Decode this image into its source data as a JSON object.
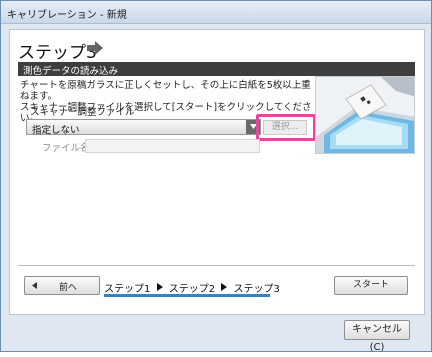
{
  "window": {
    "title": "キャリブレーション - 新規"
  },
  "step": {
    "title": "ステップ3"
  },
  "section": {
    "title": "測色データの読み込み"
  },
  "instructions": {
    "line1": "チャートを原稿ガラスに正しくセットし、その上に白紙を5枚以上重ねます。",
    "line2": "スキャナー調整ファイルを選択して[スタート]をクリックしてください。"
  },
  "scanner_file": {
    "label": "スキャナー調整ファイル",
    "selected": "指定しない",
    "select_button": "選択..."
  },
  "file_name": {
    "label": "ファイル名",
    "value": ""
  },
  "nav": {
    "prev": "前へ",
    "start": "スタート",
    "steps": [
      "ステップ1",
      "ステップ2",
      "ステップ3"
    ]
  },
  "footer": {
    "cancel": "キャンセル(C)"
  },
  "colors": {
    "highlight": "#e14a9c",
    "progress": "#2f86c6",
    "section_bg": "#3e3e3e"
  }
}
